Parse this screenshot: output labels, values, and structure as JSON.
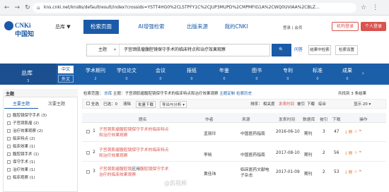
{
  "browser": {
    "url": "kns.cnki.net/kns8s/defaultresult/index?crossids=YSTT4HG0%2CLSTPFY1C%2CJUP3MUPD%2CMPMFIG1A%2CWQ0UVIAA%2CBLZ...",
    "nav_icons": [
      "back-icon",
      "forward-icon",
      "reload-icon"
    ],
    "right_icons": [
      "star-icon",
      "menu-icon"
    ]
  },
  "header": {
    "logo_text": "CNKi中国知网",
    "home_label": "总库 ▼",
    "tabs": [
      "检索页面",
      "AI增强检索",
      "出版来源",
      "我的CNKI"
    ],
    "login_label": "登录 | 会员",
    "org_button": "机构登录",
    "personal_button": "个人登录"
  },
  "search": {
    "field": "主题",
    "query": "子宫颈肌瘤腹腔镜保守手术的临床特点和治疗效果观察",
    "go_label": "🔍",
    "ask_label": "问答",
    "advanced_label": "结果中检索",
    "knowledge_label": "检索设置"
  },
  "category_bar": {
    "zongku_label": "总库",
    "zongku_count": "3",
    "lang_zh": "中文",
    "lang_en": "外文",
    "items": [
      {
        "label": "学术期刊",
        "count": "2"
      },
      {
        "label": "学位论文",
        "count": "0"
      },
      {
        "label": "会议",
        "count": "0"
      },
      {
        "label": "报纸",
        "count": "0"
      },
      {
        "label": "年鉴",
        "count": "0"
      },
      {
        "label": "图书",
        "count": "0"
      },
      {
        "label": "专利",
        "count": "0"
      },
      {
        "label": "标准",
        "count": "0"
      },
      {
        "label": "成果",
        "count": "0"
      }
    ],
    "more_label": "›"
  },
  "left_panel": {
    "title": "主题",
    "tabs": [
      "主要主题",
      "次要主题"
    ],
    "items": [
      "腹腔镜保守手术 (3)",
      "子宫颈肌瘤 (2)",
      "治疗效果观察 (2)",
      "临床特点 (2)",
      "临床效果 (1)",
      "腹腔镜手术 (1)",
      "保守手术 (1)",
      "治疗效果 (1)",
      "临床观察 (1)"
    ]
  },
  "results": {
    "crumb_prefix": "检索范围：",
    "crumb_scope": "总库",
    "crumb_query": "主题：子宫颈肌瘤腹腔镜保守手术的临床特点和治疗效果观察",
    "crumb_links": [
      "主题定制",
      "检索历史"
    ],
    "count_text": "共找到 3 条结果",
    "toolbar": {
      "select_all": "全选",
      "selected": "已选：0",
      "clear": "清除",
      "batch_download": "批量下载",
      "export": "导出与分析 ▾",
      "sort_label": "排序：",
      "sort_options": [
        "相关度",
        "发表时间",
        "被引",
        "下载",
        "综合"
      ],
      "display_label": "显示 20 ▾"
    },
    "columns": [
      "题名",
      "作者",
      "来源",
      "发表时间",
      "数据库",
      "被引",
      "下载",
      "操作"
    ],
    "rows": [
      {
        "num": "1",
        "title_hl": "子宫颈肌瘤腹腔镜保守手术的临床特点和治疗",
        "title_tail": "效果观察",
        "author": "孟丽玲",
        "source": "中国医药指南",
        "date": "2016-06-10",
        "db": "期刊",
        "cited": "3",
        "downloads": "47"
      },
      {
        "num": "2",
        "title_hl": "子宫颈肌瘤腹腔镜保守手术的临床特点和治疗",
        "title_tail": "效果观察",
        "author": "李晓",
        "source": "中国医药指南",
        "date": "2017-08-10",
        "db": "期刊",
        "cited": "2",
        "downloads": "56"
      },
      {
        "num": "3",
        "title_hl": "子宫颈肌瘤腹腔镜",
        "title_mid": "应用",
        "title_hl2": "腹腔镜保守手术治疗的临床效果观察",
        "author": "黄佳玮",
        "source": "临床医药文献电子杂志",
        "date": "2017-01-09",
        "db": "期刊",
        "cited": "2",
        "downloads": "53"
      }
    ],
    "op_icons": [
      "download-icon",
      "read-icon",
      "favorite-icon",
      "quote-icon"
    ]
  },
  "watermark": "@凯视频"
}
